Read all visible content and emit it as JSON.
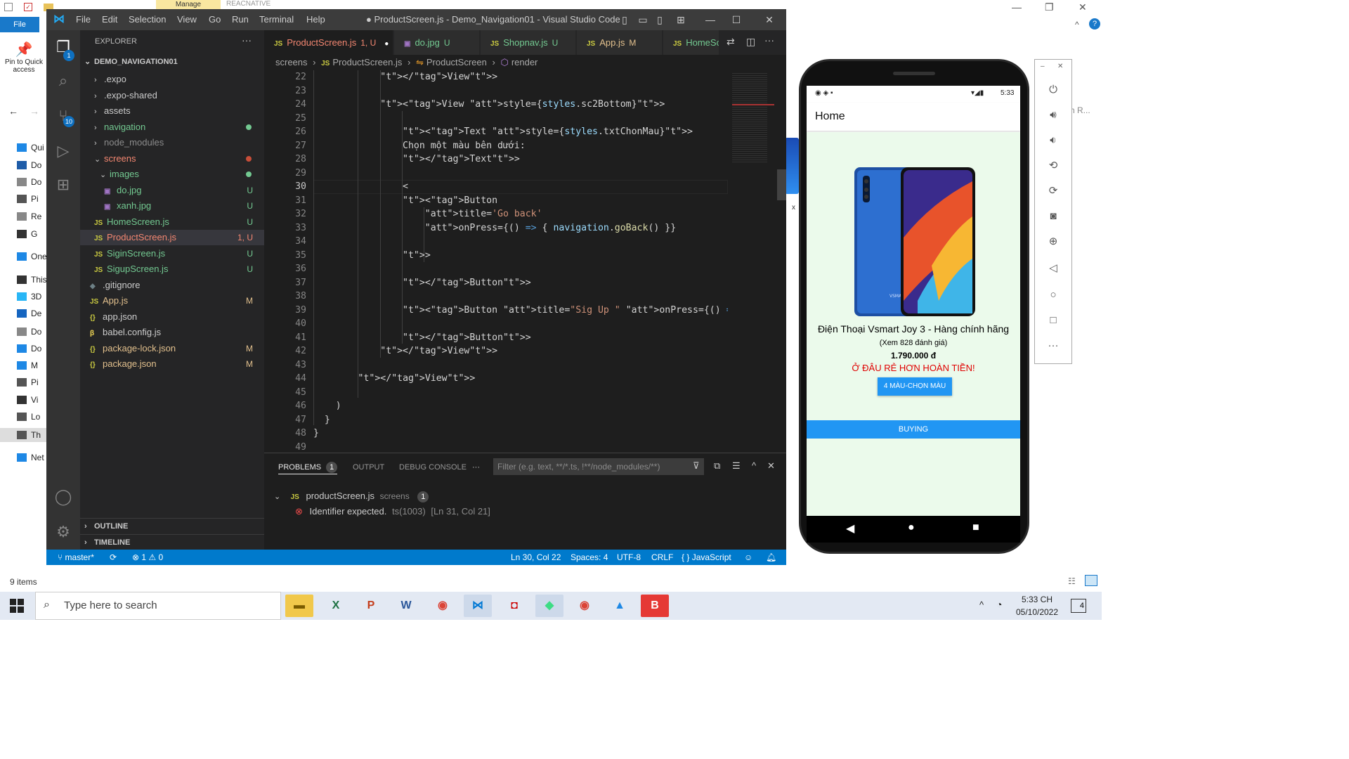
{
  "file_explorer": {
    "file_tab": "File",
    "manage_tab": "Manage",
    "ribbon_app_name": "REACNATIVE",
    "pin_label": "Pin to Quick access",
    "tree_items": [
      "Qui",
      "Do",
      "Do",
      "Pi",
      "Re",
      "G",
      "One",
      "This",
      "3D",
      "De",
      "Do",
      "Do",
      "M",
      "Pi",
      "Vi",
      "Lo",
      "Th",
      "Net"
    ],
    "status_items": "9 items",
    "search_fragment": "h R...",
    "thumb_label": "x"
  },
  "vscode": {
    "menu": [
      "File",
      "Edit",
      "Selection",
      "View",
      "Go",
      "Run",
      "Terminal",
      "Help"
    ],
    "title": "● ProductScreen.js - Demo_Navigation01 - Visual Studio Code",
    "activity_badges": {
      "explorer": "1",
      "scm": "10"
    },
    "sidebar": {
      "title": "EXPLORER",
      "root": "DEMO_NAVIGATION01",
      "items": [
        {
          "label": ".expo",
          "chev": "›",
          "icon": "",
          "color": "#cccccc",
          "badge": "",
          "dot": ""
        },
        {
          "label": ".expo-shared",
          "chev": "›",
          "icon": "",
          "color": "#cccccc",
          "badge": "",
          "dot": ""
        },
        {
          "label": "assets",
          "chev": "›",
          "icon": "",
          "color": "#cccccc",
          "badge": "",
          "dot": ""
        },
        {
          "label": "navigation",
          "chev": "›",
          "icon": "",
          "color": "#73c991",
          "badge": "",
          "dot": "#73c991"
        },
        {
          "label": "node_modules",
          "chev": "›",
          "icon": "",
          "color": "#8c8c8c",
          "badge": "",
          "dot": ""
        },
        {
          "label": "screens",
          "chev": "⌄",
          "icon": "",
          "color": "#f48771",
          "badge": "",
          "dot": "#c74e39"
        },
        {
          "label": "images",
          "chev": "⌄",
          "icon": "",
          "color": "#73c991",
          "badge": "",
          "dot": "#73c991"
        },
        {
          "label": "do.jpg",
          "chev": "",
          "icon": "IMG",
          "color": "#73c991",
          "badge": "U",
          "dot": ""
        },
        {
          "label": "xanh.jpg",
          "chev": "",
          "icon": "IMG",
          "color": "#73c991",
          "badge": "U",
          "dot": ""
        },
        {
          "label": "HomeScreen.js",
          "chev": "",
          "icon": "JS",
          "color": "#73c991",
          "badge": "U",
          "dot": ""
        },
        {
          "label": "ProductScreen.js",
          "chev": "",
          "icon": "JS",
          "color": "#f48771",
          "badge": "1, U",
          "dot": ""
        },
        {
          "label": "SiginScreen.js",
          "chev": "",
          "icon": "JS",
          "color": "#73c991",
          "badge": "U",
          "dot": ""
        },
        {
          "label": "SigupScreen.js",
          "chev": "",
          "icon": "JS",
          "color": "#73c991",
          "badge": "U",
          "dot": ""
        },
        {
          "label": ".gitignore",
          "chev": "",
          "icon": "◆",
          "color": "#cccccc",
          "badge": "",
          "dot": ""
        },
        {
          "label": "App.js",
          "chev": "",
          "icon": "JS",
          "color": "#e2c08d",
          "badge": "M",
          "dot": ""
        },
        {
          "label": "app.json",
          "chev": "",
          "icon": "{}",
          "color": "#cccccc",
          "badge": "",
          "dot": ""
        },
        {
          "label": "babel.config.js",
          "chev": "",
          "icon": "β",
          "color": "#cccccc",
          "badge": "",
          "dot": ""
        },
        {
          "label": "package-lock.json",
          "chev": "",
          "icon": "{}",
          "color": "#e2c08d",
          "badge": "M",
          "dot": ""
        },
        {
          "label": "package.json",
          "chev": "",
          "icon": "{}",
          "color": "#e2c08d",
          "badge": "M",
          "dot": ""
        }
      ],
      "outline": "OUTLINE",
      "timeline": "TIMELINE"
    },
    "tabs": [
      {
        "label": "ProductScreen.js",
        "suffix": "1, U",
        "icon": "JS",
        "active": true,
        "color": "#f48771"
      },
      {
        "label": "do.jpg",
        "suffix": "U",
        "icon": "IMG",
        "active": false,
        "color": "#73c991"
      },
      {
        "label": "Shopnav.js",
        "suffix": "U",
        "icon": "JS",
        "active": false,
        "color": "#73c991"
      },
      {
        "label": "App.js",
        "suffix": "M",
        "icon": "JS",
        "active": false,
        "color": "#e2c08d"
      },
      {
        "label": "HomeScr",
        "suffix": "",
        "icon": "JS",
        "active": false,
        "color": "#73c991"
      }
    ],
    "breadcrumb": [
      "screens",
      "ProductScreen.js",
      "ProductScreen",
      "render"
    ],
    "line_numbers": [
      "22",
      "23",
      "24",
      "25",
      "26",
      "27",
      "28",
      "29",
      "30",
      "31",
      "32",
      "33",
      "34",
      "35",
      "36",
      "37",
      "38",
      "39",
      "40",
      "41",
      "42",
      "43",
      "44",
      "45",
      "46",
      "47",
      "48",
      "49"
    ],
    "current_line": "30",
    "code_lines": [
      "            </View>",
      "",
      "            <View style={styles.sc2Bottom}>",
      "",
      "                <Text style={styles.txtChonMau}>",
      "                Chọn một màu bên dưới:",
      "                </Text>",
      "",
      "                <",
      "                <Button",
      "                    title='Go back'",
      "                    onPress={() => { navigation.goBack() }}",
      "",
      "                >",
      "",
      "                </Button>",
      "",
      "                <Button title=\"Sig Up \" onPress={() => { navigation.nav",
      "",
      "                </Button>",
      "            </View>",
      "",
      "        </View>",
      "",
      "    )",
      "  }",
      "}",
      ""
    ],
    "panel": {
      "tabs": [
        "PROBLEMS",
        "OUTPUT",
        "DEBUG CONSOLE"
      ],
      "problems_count": "1",
      "filter_placeholder": "Filter (e.g. text, **/*.ts, !**/node_modules/**)",
      "file": "productScreen.js",
      "folder": "screens",
      "file_count": "1",
      "error_message": "Identifier expected.",
      "error_code": "ts(1003)",
      "error_location": "[Ln 31, Col 21]"
    },
    "statusbar": {
      "branch": "master*",
      "errors": "1",
      "warnings": "0",
      "position": "Ln 30, Col 22",
      "spaces": "Spaces: 4",
      "encoding": "UTF-8",
      "eol": "CRLF",
      "language": "JavaScript"
    }
  },
  "phone": {
    "time": "5:33",
    "header_title": "Home",
    "product_name": "Điện Thoại Vsmart Joy 3 - Hàng chính hãng",
    "reviews": "(Xem 828 đánh giá)",
    "price": "1.790.000 đ",
    "promo": "Ở ĐÂU RẺ HƠN HOÀN TIỀN!",
    "color_button": "4 MÀU-CHỌN MÀU",
    "buy_button": "BUYING",
    "phone_brand": "VSMART"
  },
  "taskbar": {
    "search_placeholder": "Type here to search",
    "time": "5:33 CH",
    "date": "05/10/2022",
    "notification_count": "4"
  }
}
